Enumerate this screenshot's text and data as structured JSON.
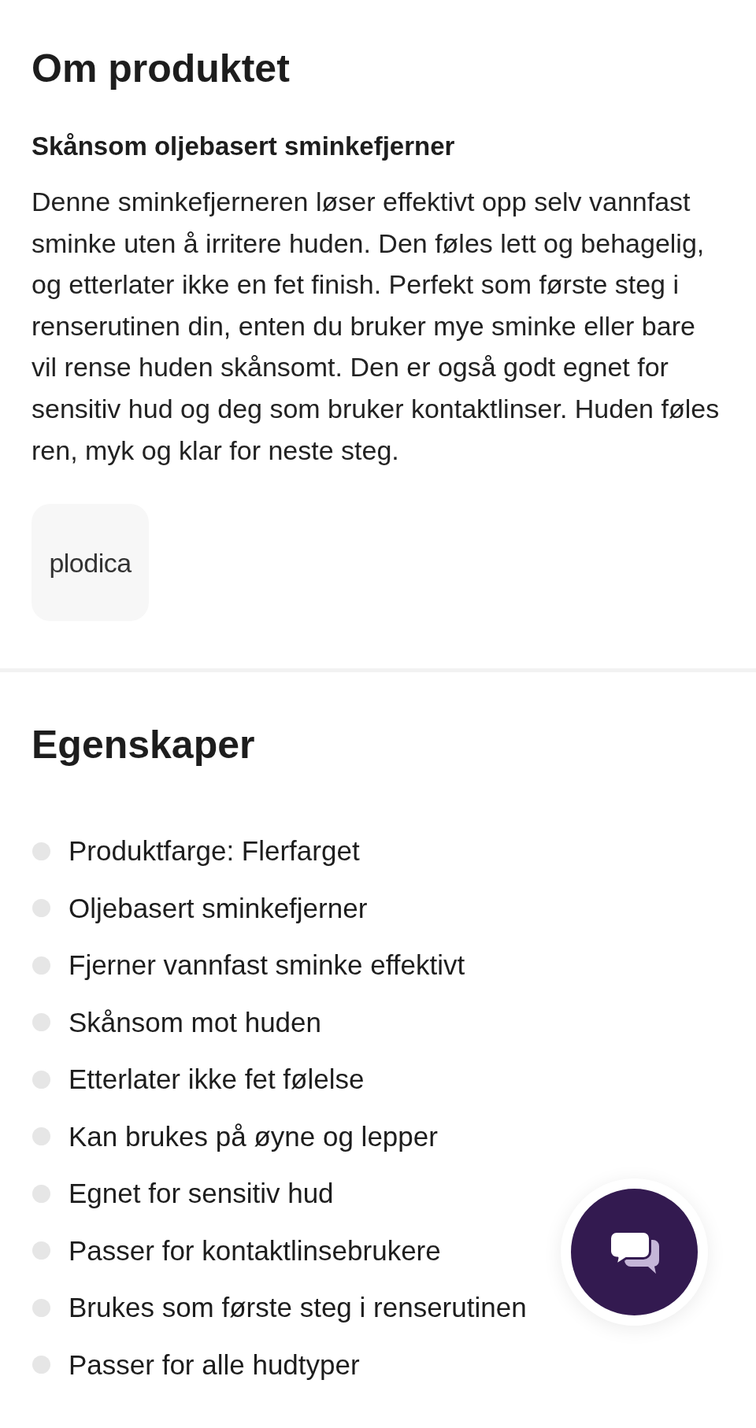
{
  "about": {
    "title": "Om produktet",
    "subtitle": "Skånsom oljebasert sminkefjerner",
    "description": "Denne sminkefjerneren løser effektivt opp selv vannfast sminke uten å irritere huden. Den føles lett og behagelig, og etterlater ikke en fet finish. Perfekt som første steg i renserutinen din, enten du bruker mye sminke eller bare vil rense huden skånsomt. Den er også godt egnet for sensitiv hud og deg som bruker kontaktlinser. Huden føles ren, myk og klar for neste steg.",
    "brand_logo": "plodica"
  },
  "features": {
    "title": "Egenskaper",
    "items": [
      "Produktfarge: Flerfarget",
      "Oljebasert sminkefjerner",
      "Fjerner vannfast sminke effektivt",
      "Skånsom mot huden",
      "Etterlater ikke fet følelse",
      "Kan brukes på øyne og lepper",
      "Egnet for sensitiv hud",
      "Passer for kontaktlinsebrukere",
      "Brukes som første steg i renserutinen",
      "Passer for alle hudtyper"
    ]
  }
}
